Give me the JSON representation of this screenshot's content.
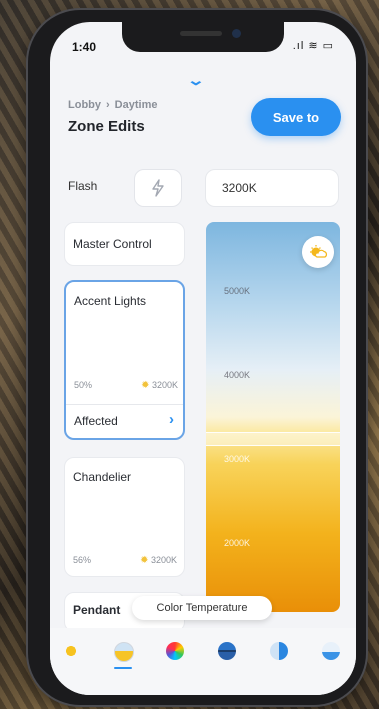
{
  "status_bar": {
    "time": "1:40",
    "icons": ".ıl ≋ ▭"
  },
  "header": {
    "breadcrumb": [
      "Lobby",
      "Daytime"
    ],
    "breadcrumb_sep": "›",
    "title": "Zone Edits",
    "save_label": "Save to"
  },
  "flash": {
    "label": "Flash",
    "icon": "lightning-icon"
  },
  "kelvin_field": {
    "value": "3200K"
  },
  "cards": {
    "master": {
      "name": "Master Control"
    },
    "accent": {
      "name": "Accent Lights",
      "brightness": "50%",
      "temp": "3200K",
      "affected_label": "Affected"
    },
    "chandelier": {
      "name": "Chandelier",
      "brightness": "56%",
      "temp": "3200K"
    },
    "pendant": {
      "name": "Pendant"
    }
  },
  "slider": {
    "ticks": [
      "5000K",
      "4000K",
      "3000K",
      "2000K"
    ],
    "selected": "3200K"
  },
  "tooltip": {
    "text": "Color Temperature"
  },
  "tabs": [
    {
      "name": "tab-brightness",
      "icon": "sun-icon"
    },
    {
      "name": "tab-color-temperature",
      "icon": "temperature-icon",
      "active": true
    },
    {
      "name": "tab-color-wheel",
      "icon": "color-wheel-icon"
    },
    {
      "name": "tab-scene",
      "icon": "horizon-icon"
    },
    {
      "name": "tab-saturation",
      "icon": "half-circle-icon"
    },
    {
      "name": "tab-effects",
      "icon": "wave-icon"
    }
  ],
  "colors": {
    "accent": "#2a90f0",
    "selected_border": "#6aa4e6"
  }
}
